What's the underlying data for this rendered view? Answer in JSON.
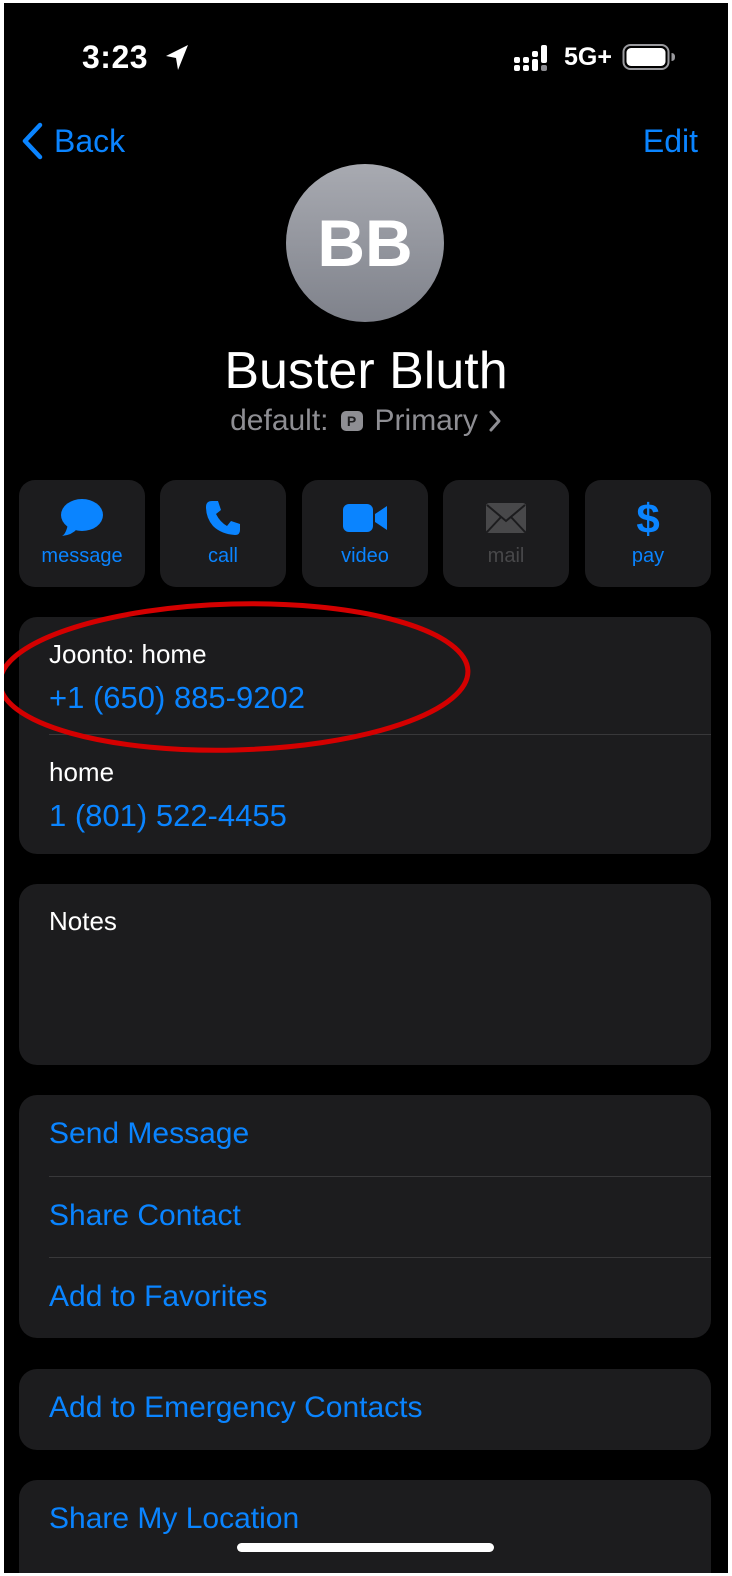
{
  "status_bar": {
    "time": "3:23",
    "network": "5G+",
    "icons": [
      "location-arrow-icon",
      "signal-icon",
      "battery-icon"
    ]
  },
  "nav": {
    "back_label": "Back",
    "edit_label": "Edit"
  },
  "contact": {
    "initials": "BB",
    "name": "Buster Bluth",
    "default_prefix": "default:",
    "default_badge": "P",
    "default_value": "Primary"
  },
  "actions": [
    {
      "label": "message",
      "icon": "message-bubble-icon",
      "enabled": true
    },
    {
      "label": "call",
      "icon": "phone-icon",
      "enabled": true
    },
    {
      "label": "video",
      "icon": "video-camera-icon",
      "enabled": true
    },
    {
      "label": "mail",
      "icon": "mail-envelope-icon",
      "enabled": false
    },
    {
      "label": "pay",
      "icon": "dollar-sign-icon",
      "enabled": true
    }
  ],
  "phones": [
    {
      "label": "Joonto: home",
      "number": "+1 (650) 885-9202"
    },
    {
      "label": "home",
      "number": "1 (801) 522-4455"
    }
  ],
  "notes": {
    "label": "Notes"
  },
  "links": {
    "send_message": "Send Message",
    "share_contact": "Share Contact",
    "add_favorites": "Add to Favorites",
    "emergency": "Add to Emergency Contacts",
    "share_location": "Share My Location"
  },
  "colors": {
    "accent": "#0a84ff",
    "background": "#000000",
    "card": "#1c1c1e",
    "annotation": "#d40000"
  }
}
